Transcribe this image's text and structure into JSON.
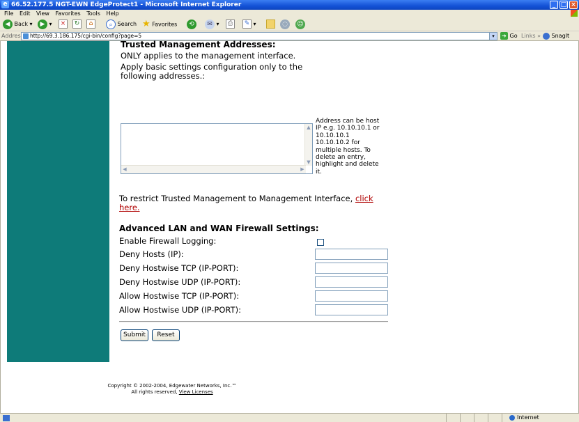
{
  "window": {
    "title": "66.52.177.5 NGT-EWN EdgeProtect1 - Microsoft Internet Explorer",
    "buttons": [
      "_",
      "□",
      "×"
    ]
  },
  "menu": {
    "items": [
      "File",
      "Edit",
      "View",
      "Favorites",
      "Tools",
      "Help"
    ]
  },
  "toolbar": {
    "back_label": "Back",
    "search_label": "Search",
    "favorites_label": "Favorites"
  },
  "address_bar": {
    "label": "Address",
    "url": "http://69.3.186.175/cgi-bin/config?page=5",
    "go_label": "Go",
    "links_label": "Links",
    "snagit_label": "SnagIt"
  },
  "trusted": {
    "heading": "Trusted Management Addresses:",
    "line1": "ONLY applies to the management interface.",
    "line2": "Apply basic settings configuration only to the",
    "line3": "following addresses.:",
    "help_lines": [
      "Address can be host",
      "IP e.g. 10.10.10.1 or",
      "10.10.10.1",
      "10.10.10.2 for",
      "multiple hosts. To",
      "delete an entry,",
      "highlight and delete",
      "it."
    ],
    "restrict_text": "To restrict Trusted Management to Management Interface,",
    "restrict_link_1": "click",
    "restrict_link_2": "here."
  },
  "firewall": {
    "heading": "Advanced LAN and WAN Firewall Settings:",
    "enable_logging_label": "Enable Firewall Logging:",
    "enable_logging_checked": false,
    "fields": [
      {
        "label": "Deny Hosts (IP):",
        "value": ""
      },
      {
        "label": "Deny Hostwise TCP (IP-PORT):",
        "value": ""
      },
      {
        "label": "Deny Hostwise UDP (IP-PORT):",
        "value": ""
      },
      {
        "label": "Allow Hostwise TCP (IP-PORT):",
        "value": ""
      },
      {
        "label": "Allow Hostwise UDP (IP-PORT):",
        "value": ""
      }
    ]
  },
  "actions": {
    "submit_label": "Submit",
    "reset_label": "Reset"
  },
  "footer": {
    "copyright": "Copyright © 2002-2004, Edgewater Networks, Inc.™",
    "rights": "All rights reserved,",
    "license_link": "View Licenses"
  },
  "status_bar": {
    "zone": "Internet"
  },
  "colors": {
    "sidebar": "#0e7b79",
    "link": "#b00000",
    "titlebar": "#1452d6"
  }
}
